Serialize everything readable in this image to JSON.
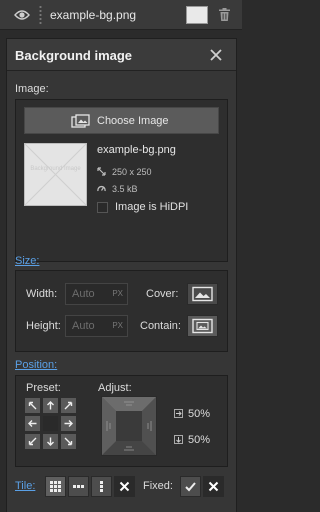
{
  "layer": {
    "name": "example-bg.png",
    "swatch_color": "#e9e9e9",
    "visibility_icon": "eye-icon",
    "delete_icon": "trash-icon"
  },
  "panel": {
    "title": "Background image",
    "close_icon": "close-icon"
  },
  "image": {
    "section_label": "Image:",
    "choose_label": "Choose Image",
    "choose_icon": "images-icon",
    "thumbnail_text": "Background Image",
    "file_name": "example-bg.png",
    "dimensions": "250 x 250",
    "file_size": "3.5 kB",
    "hidpi_label": "Image is HiDPI",
    "hidpi_checked": false
  },
  "size": {
    "section_label": "Size:",
    "width_label": "Width:",
    "width_value": "Auto",
    "width_unit": "PX",
    "height_label": "Height:",
    "height_value": "Auto",
    "height_unit": "PX",
    "cover_label": "Cover:",
    "contain_label": "Contain:",
    "selected_mode": "contain"
  },
  "position": {
    "section_label": "Position:",
    "preset_label": "Preset:",
    "adjust_label": "Adjust:",
    "selected_preset": "center",
    "x_value": "50%",
    "y_value": "50%"
  },
  "tile": {
    "section_label": "Tile:",
    "options": [
      "tile-both",
      "tile-horizontal",
      "tile-vertical",
      "no-tile"
    ],
    "selected": "tile-both",
    "fixed_label": "Fixed:",
    "fixed_selected": "no"
  },
  "colors": {
    "accent": "#5aa0e6",
    "panel_bg": "#363636",
    "box_bg": "#2e2e2e"
  }
}
